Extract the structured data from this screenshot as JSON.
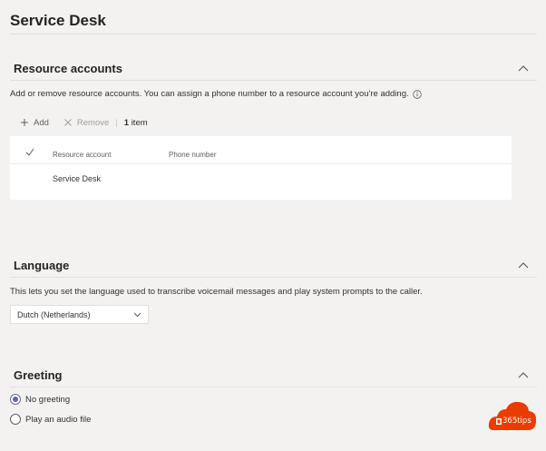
{
  "page": {
    "title": "Service Desk"
  },
  "resource_accounts": {
    "title": "Resource accounts",
    "description": "Add or remove resource accounts. You can assign a phone number to a resource account you're adding.",
    "toolbar": {
      "add_label": "Add",
      "remove_label": "Remove",
      "count_number": "1",
      "count_label": "item"
    },
    "table": {
      "columns": [
        "Resource account",
        "Phone number"
      ],
      "rows": [
        {
          "account": "Service Desk",
          "phone": ""
        }
      ]
    }
  },
  "language": {
    "title": "Language",
    "description": "This lets you set the language used to transcribe voicemail messages and play system prompts to the caller.",
    "selected": "Dutch (Netherlands)"
  },
  "greeting": {
    "title": "Greeting",
    "options": [
      {
        "label": "No greeting",
        "checked": true
      },
      {
        "label": "Play an audio file",
        "checked": false
      }
    ]
  },
  "badge": {
    "text": "365tips",
    "color": "#eb3c00"
  },
  "colors": {
    "accent": "#6264a7",
    "background": "#f3f2f1"
  }
}
